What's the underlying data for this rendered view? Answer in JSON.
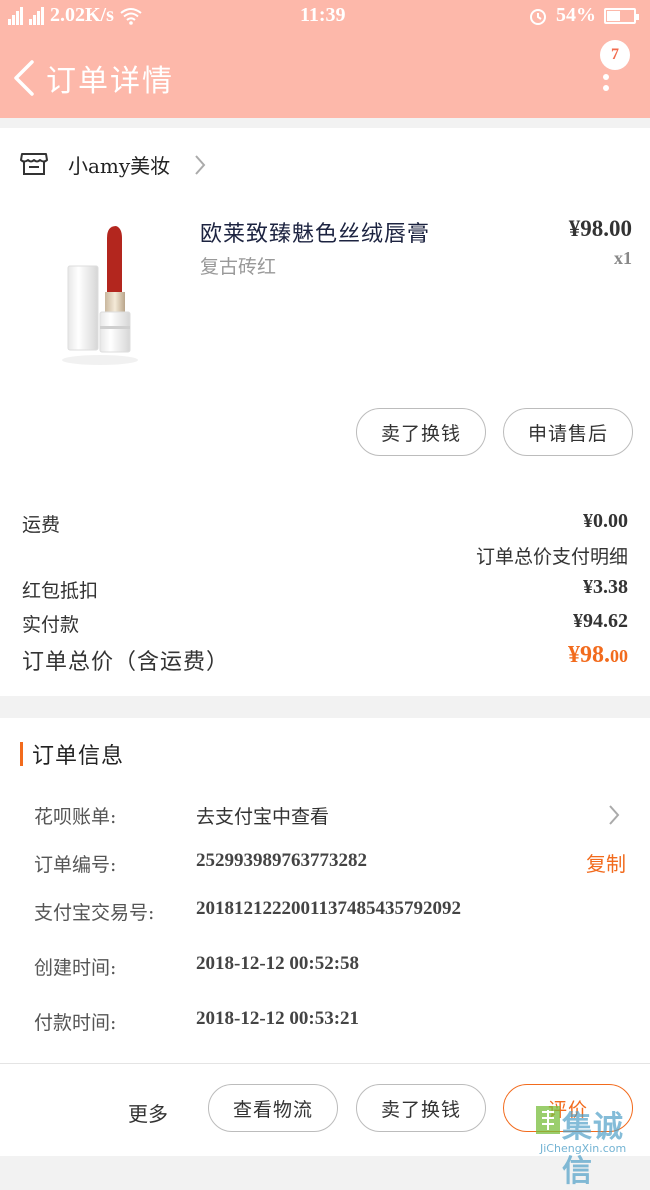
{
  "status_bar": {
    "network_speed": "2.02K/s",
    "time": "11:39",
    "battery": "54%",
    "battery_level": 0.54
  },
  "nav": {
    "title": "订单详情",
    "badge_count": "7"
  },
  "shop": {
    "name": "小amy美妆"
  },
  "product": {
    "name": "欧莱致臻魅色丝绒唇膏",
    "variant": "复古砖红",
    "price": "¥98.00",
    "quantity": "x1"
  },
  "actions": {
    "sell_label": "卖了换钱",
    "after_sales_label": "申请售后"
  },
  "fees": {
    "shipping_label": "运费",
    "shipping_value": "¥0.00",
    "detail_link": "订单总价支付明细",
    "red_packet_label": "红包抵扣",
    "red_packet_value": "¥3.38",
    "paid_label": "实付款",
    "paid_value": "¥94.62",
    "total_label": "订单总价（含运费）",
    "total_value_main": "¥98.",
    "total_value_cents": "00"
  },
  "order_info": {
    "title": "订单信息",
    "rows": [
      {
        "label": "花呗账单:",
        "value": "去支付宝中查看"
      },
      {
        "label": "订单编号:",
        "value": "252993989763773282",
        "action": "复制"
      },
      {
        "label": "支付宝交易号:",
        "value": "2018121222001137485435792092"
      },
      {
        "label": "创建时间:",
        "value": "2018-12-12 00:52:58"
      },
      {
        "label": "付款时间:",
        "value": "2018-12-12 00:53:21"
      }
    ]
  },
  "bottom_bar": {
    "more_label": "更多",
    "logistics_label": "查看物流",
    "sell_label": "卖了换钱",
    "review_label": "评价"
  },
  "watermark": {
    "text": "集诚信",
    "subtext": "JiChengXin.com"
  },
  "colors": {
    "header": "#fdb8aa",
    "accent": "#f26b1d",
    "background": "#f2f2f2"
  }
}
